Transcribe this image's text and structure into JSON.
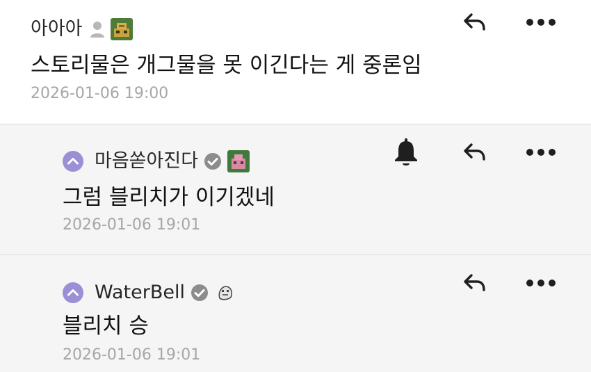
{
  "comments": [
    {
      "author": "아아아",
      "text": "스토리물은 개그물을 못 이긴다는 게 중론임",
      "time": "2026-01-06 19:00",
      "has_bell": false,
      "reply": true
    },
    {
      "author": "마음쏟아진다",
      "text": "그럼 블리치가 이기겠네",
      "time": "2026-01-06 19:01",
      "has_bell": true,
      "reply": true
    },
    {
      "author": "WaterBell",
      "text": "블리치 승",
      "time": "2026-01-06 19:01",
      "has_bell": false,
      "reply": true
    }
  ],
  "icons": {
    "reply": "reply-arrow-icon",
    "more": "more-dots-icon",
    "bell": "bell-icon",
    "collapse": "chevron-up-icon",
    "verified": "verified-check-icon",
    "person": "person-icon"
  },
  "colors": {
    "accent_purple": "#9b8fd6",
    "meta_gray": "#a6a6a6",
    "reply_bg": "#f5f5f5"
  }
}
